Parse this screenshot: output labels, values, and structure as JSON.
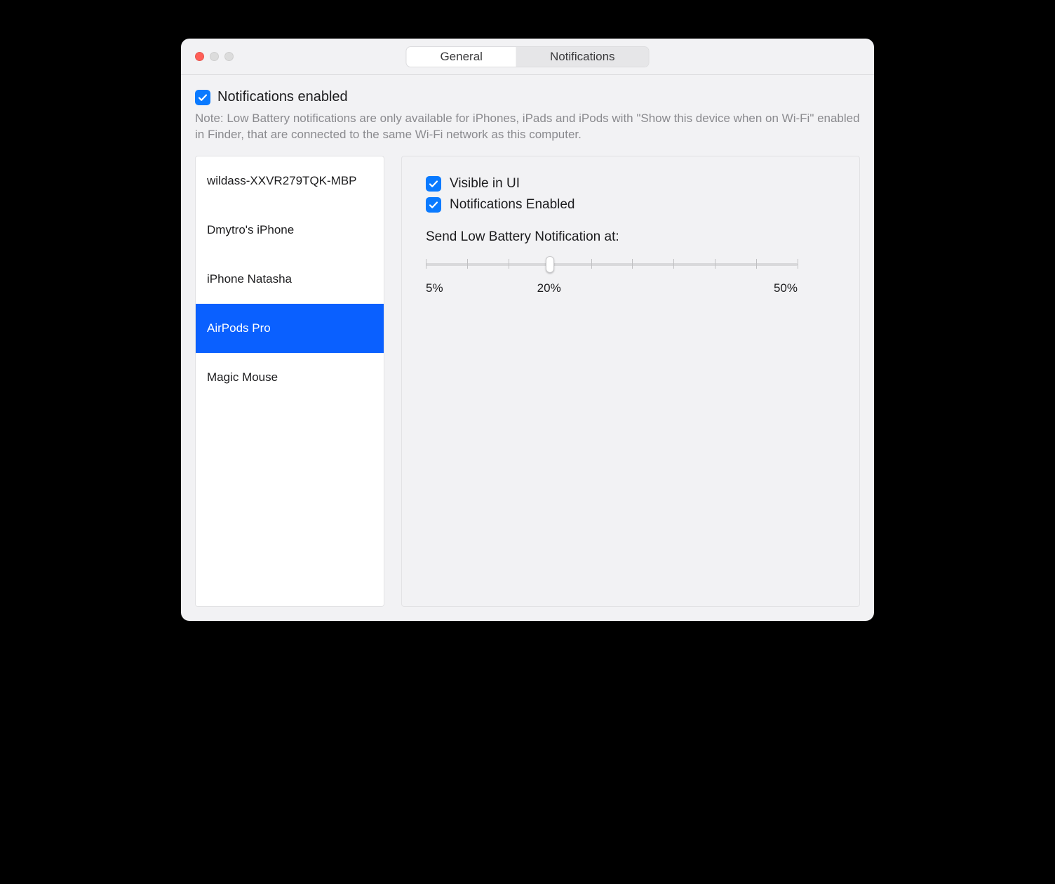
{
  "tabs": {
    "general": "General",
    "notifications": "Notifications",
    "active": "notifications"
  },
  "master_checkbox": {
    "checked": true,
    "label": "Notifications enabled"
  },
  "note": "Note: Low Battery notifications are only available for iPhones, iPads and iPods with \"Show this device when on Wi-Fi\" enabled in Finder, that are connected to the same Wi-Fi network as this computer.",
  "devices": [
    {
      "name": "wildass-XXVR279TQK-MBP",
      "selected": false
    },
    {
      "name": "Dmytro's iPhone",
      "selected": false
    },
    {
      "name": "iPhone Natasha",
      "selected": false
    },
    {
      "name": "AirPods Pro",
      "selected": true
    },
    {
      "name": "Magic Mouse",
      "selected": false
    }
  ],
  "detail": {
    "visible_in_ui": {
      "checked": true,
      "label": "Visible in UI"
    },
    "notifications_enabled": {
      "checked": true,
      "label": "Notifications Enabled"
    },
    "slider": {
      "title": "Send Low Battery Notification at:",
      "min": 5,
      "max": 50,
      "value": 20,
      "ticks": 10,
      "labels": {
        "min": "5%",
        "mid": "20%",
        "max": "50%"
      }
    }
  }
}
